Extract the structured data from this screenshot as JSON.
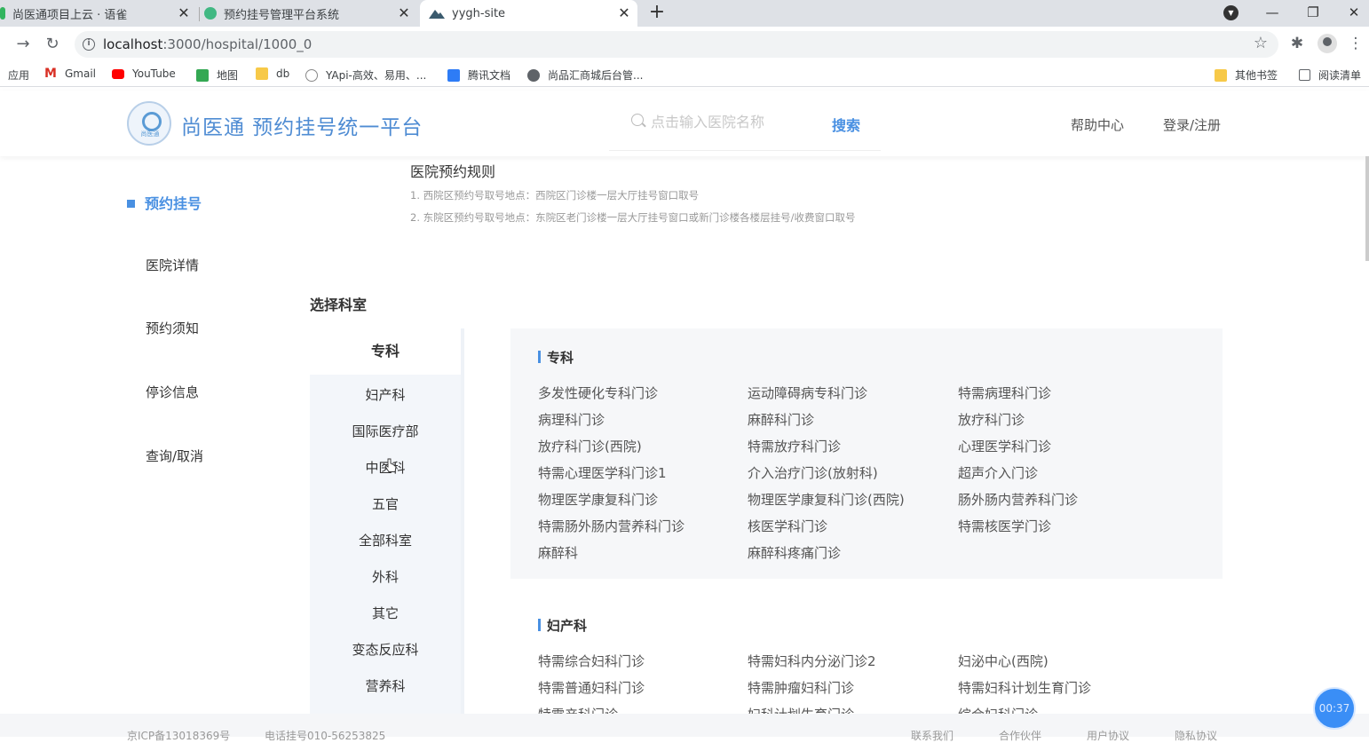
{
  "browser": {
    "tabs": [
      {
        "title": "尚医通项目上云 · 语雀"
      },
      {
        "title": "预约挂号管理平台系统"
      },
      {
        "title": "yygh-site"
      }
    ],
    "url_host": "localhost",
    "url_path": ":3000/hospital/1000_0",
    "bookmarks": [
      "应用",
      "Gmail",
      "YouTube",
      "地图",
      "db",
      "YApi-高效、易用、...",
      "腾讯文档",
      "尚品汇商城后台管...",
      "其他书签",
      "阅读清单"
    ]
  },
  "header": {
    "site_title": "尚医通 预约挂号统一平台",
    "logo_text": "尚医通",
    "search_placeholder": "点击输入医院名称",
    "search_button": "搜索",
    "help": "帮助中心",
    "login": "登录/注册"
  },
  "left_nav": {
    "items": [
      "预约挂号",
      "医院详情",
      "预约须知",
      "停诊信息",
      "查询/取消"
    ],
    "active": "预约挂号"
  },
  "rules": {
    "title": "医院预约规则",
    "lines": [
      "1. 西院区预约号取号地点：西院区门诊楼一层大厅挂号窗口取号",
      "2. 东院区预约号取号地点：东院区老门诊楼一层大厅挂号窗口或新门诊楼各楼层挂号/收费窗口取号"
    ]
  },
  "dept_section_title": "选择科室",
  "departments": [
    "专科",
    "妇产科",
    "国际医疗部",
    "中医科",
    "五官",
    "全部科室",
    "外科",
    "其它",
    "变态反应科",
    "营养科"
  ],
  "groups": [
    {
      "name": "专科",
      "items": [
        "多发性硬化专科门诊",
        "运动障碍病专科门诊",
        "特需病理科门诊",
        "病理科门诊",
        "麻醉科门诊",
        "放疗科门诊",
        "放疗科门诊(西院)",
        "特需放疗科门诊",
        "心理医学科门诊",
        "特需心理医学科门诊1",
        "介入治疗门诊(放射科)",
        "超声介入门诊",
        "物理医学康复科门诊",
        "物理医学康复科门诊(西院)",
        "肠外肠内营养科门诊",
        "特需肠外肠内营养科门诊",
        "核医学科门诊",
        "特需核医学门诊",
        "麻醉科",
        "麻醉科疼痛门诊"
      ]
    },
    {
      "name": "妇产科",
      "items": [
        "特需综合妇科门诊",
        "特需妇科内分泌门诊2",
        "妇泌中心(西院)",
        "特需普通妇科门诊",
        "特需肿瘤妇科门诊",
        "特需妇科计划生育门诊",
        "特需产科门诊",
        "妇科计划生育门诊",
        "综合妇科门诊"
      ]
    }
  ],
  "footer": {
    "icp": "京ICP备13018369号",
    "phone": "电话挂号010-56253825",
    "links": [
      "联系我们",
      "合作伙伴",
      "用户协议",
      "隐私协议"
    ]
  },
  "timer": "00:37",
  "colors": {
    "accent": "#4990e2",
    "title": "#4f8cd3"
  }
}
